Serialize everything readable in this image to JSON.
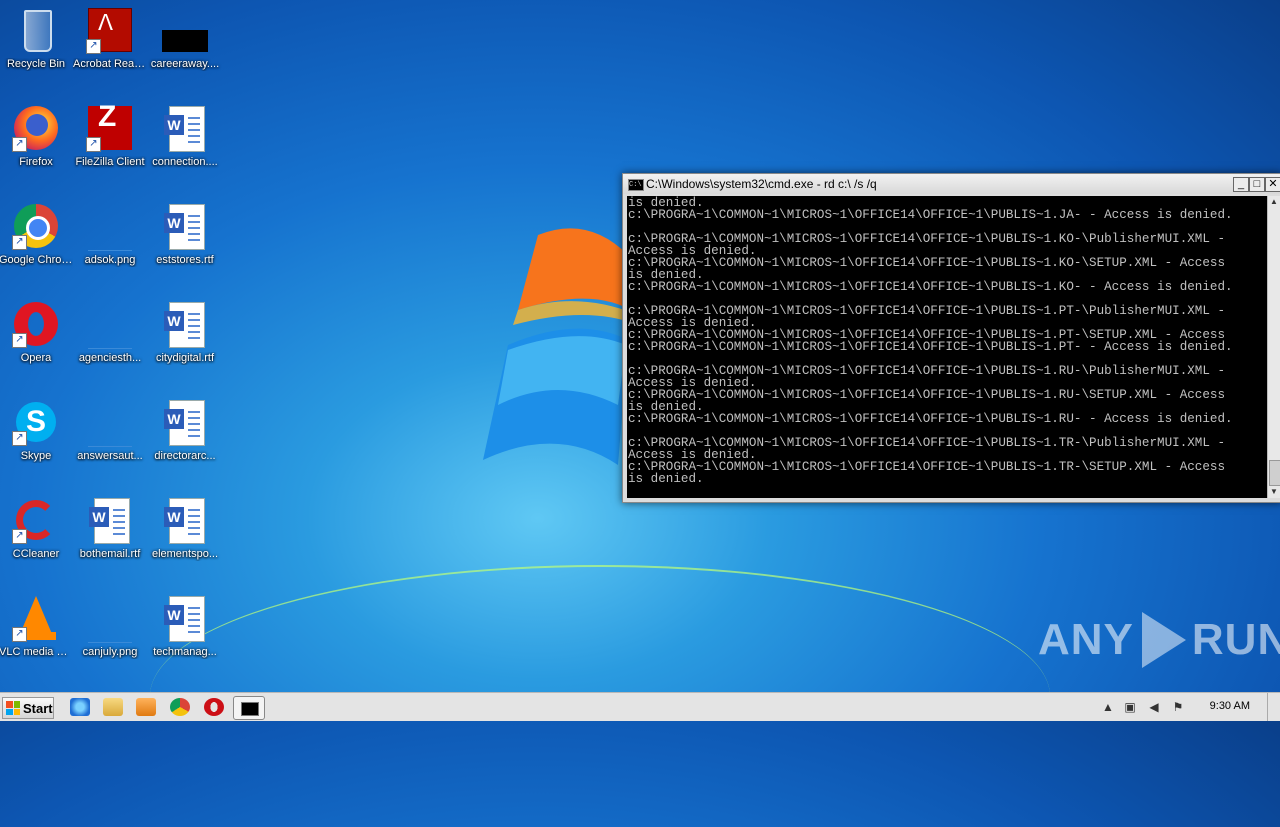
{
  "desktop": {
    "icons": [
      {
        "label": "Recycle Bin",
        "kind": "recycle-bin",
        "shortcut": false
      },
      {
        "label": "Acrobat Reader DC",
        "kind": "acrobat",
        "shortcut": true
      },
      {
        "label": "careeraway....",
        "kind": "black-image",
        "shortcut": false
      },
      {
        "label": "Firefox",
        "kind": "firefox",
        "shortcut": true
      },
      {
        "label": "FileZilla Client",
        "kind": "filezilla",
        "shortcut": true
      },
      {
        "label": "connection....",
        "kind": "word-doc",
        "shortcut": false
      },
      {
        "label": "Google Chrome",
        "kind": "chrome",
        "shortcut": true
      },
      {
        "label": "adsok.png",
        "kind": "png",
        "shortcut": false
      },
      {
        "label": "eststores.rtf",
        "kind": "word-doc",
        "shortcut": false
      },
      {
        "label": "Opera",
        "kind": "opera",
        "shortcut": true
      },
      {
        "label": "agenciesth...",
        "kind": "png",
        "shortcut": false
      },
      {
        "label": "citydigital.rtf",
        "kind": "word-doc",
        "shortcut": false
      },
      {
        "label": "Skype",
        "kind": "skype",
        "shortcut": true
      },
      {
        "label": "answersaut...",
        "kind": "png",
        "shortcut": false
      },
      {
        "label": "directorarc...",
        "kind": "word-doc",
        "shortcut": false
      },
      {
        "label": "CCleaner",
        "kind": "ccleaner",
        "shortcut": true
      },
      {
        "label": "bothemail.rtf",
        "kind": "word-doc",
        "shortcut": false
      },
      {
        "label": "elementspo...",
        "kind": "word-doc",
        "shortcut": false
      },
      {
        "label": "VLC media player",
        "kind": "vlc",
        "shortcut": true
      },
      {
        "label": "canjuly.png",
        "kind": "png",
        "shortcut": false
      },
      {
        "label": "techmanag...",
        "kind": "word-doc",
        "shortcut": false
      }
    ]
  },
  "cmd_window": {
    "title": "C:\\Windows\\system32\\cmd.exe - rd  c:\\ /s /q",
    "icon_text": "C:\\",
    "minimize": "_",
    "maximize": "□",
    "close": "✕",
    "lines": [
      "is denied.",
      "c:\\PROGRA~1\\COMMON~1\\MICROS~1\\OFFICE14\\OFFICE~1\\PUBLIS~1.JA- - Access is denied.",
      "",
      "c:\\PROGRA~1\\COMMON~1\\MICROS~1\\OFFICE14\\OFFICE~1\\PUBLIS~1.KO-\\PublisherMUI.XML -",
      "Access is denied.",
      "c:\\PROGRA~1\\COMMON~1\\MICROS~1\\OFFICE14\\OFFICE~1\\PUBLIS~1.KO-\\SETUP.XML - Access",
      "is denied.",
      "c:\\PROGRA~1\\COMMON~1\\MICROS~1\\OFFICE14\\OFFICE~1\\PUBLIS~1.KO- - Access is denied.",
      "",
      "c:\\PROGRA~1\\COMMON~1\\MICROS~1\\OFFICE14\\OFFICE~1\\PUBLIS~1.PT-\\PublisherMUI.XML -",
      "Access is denied.",
      "c:\\PROGRA~1\\COMMON~1\\MICROS~1\\OFFICE14\\OFFICE~1\\PUBLIS~1.PT-\\SETUP.XML - Access",
      "c:\\PROGRA~1\\COMMON~1\\MICROS~1\\OFFICE14\\OFFICE~1\\PUBLIS~1.PT- - Access is denied.",
      "",
      "c:\\PROGRA~1\\COMMON~1\\MICROS~1\\OFFICE14\\OFFICE~1\\PUBLIS~1.RU-\\PublisherMUI.XML -",
      "Access is denied.",
      "c:\\PROGRA~1\\COMMON~1\\MICROS~1\\OFFICE14\\OFFICE~1\\PUBLIS~1.RU-\\SETUP.XML - Access",
      "is denied.",
      "c:\\PROGRA~1\\COMMON~1\\MICROS~1\\OFFICE14\\OFFICE~1\\PUBLIS~1.RU- - Access is denied.",
      "",
      "c:\\PROGRA~1\\COMMON~1\\MICROS~1\\OFFICE14\\OFFICE~1\\PUBLIS~1.TR-\\PublisherMUI.XML -",
      "Access is denied.",
      "c:\\PROGRA~1\\COMMON~1\\MICROS~1\\OFFICE14\\OFFICE~1\\PUBLIS~1.TR-\\SETUP.XML - Access",
      "is denied."
    ]
  },
  "taskbar": {
    "start_label": "Start",
    "pinned": [
      "internet-explorer-icon",
      "windows-explorer-icon",
      "media-player-icon",
      "chrome-icon",
      "opera-icon",
      "cmd-icon"
    ],
    "tray": {
      "expand": "▲",
      "time": "9:30 AM"
    }
  },
  "watermark": {
    "left": "ANY",
    "right": "RUN"
  },
  "colors": {
    "desktop_blue": "#1673cf",
    "taskbar": "#e4e4e4",
    "console_bg": "#000000",
    "console_text": "#c0c0c0"
  }
}
